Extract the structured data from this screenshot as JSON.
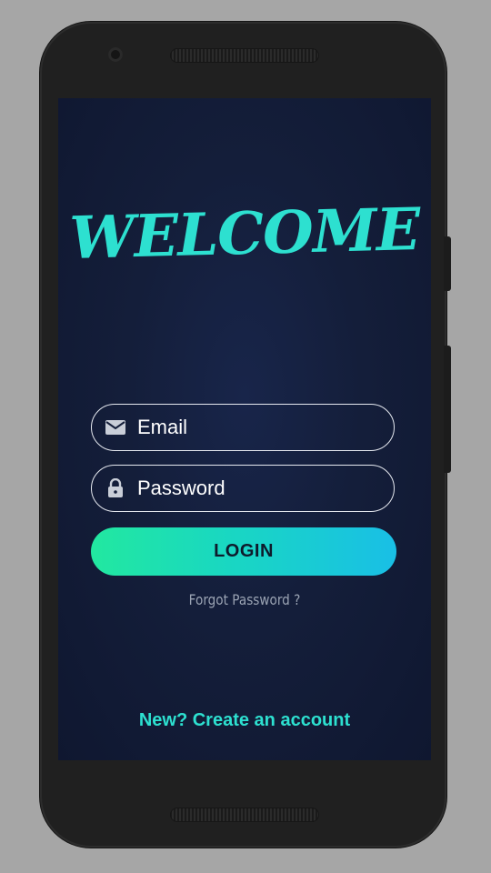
{
  "welcome": {
    "title": "WELCOME"
  },
  "form": {
    "email": {
      "placeholder": "Email",
      "value": ""
    },
    "password": {
      "placeholder": "Password",
      "value": ""
    },
    "login_label": "LOGIN",
    "forgot_label": "Forgot Password ?"
  },
  "footer": {
    "create_account_label": "New? Create an account"
  },
  "icons": {
    "email": "mail-icon",
    "password": "lock-icon"
  },
  "colors": {
    "accent": "#2de0d0",
    "background": "#141e3a",
    "login_gradient_start": "#22e8a0",
    "login_gradient_end": "#19bfe6"
  }
}
